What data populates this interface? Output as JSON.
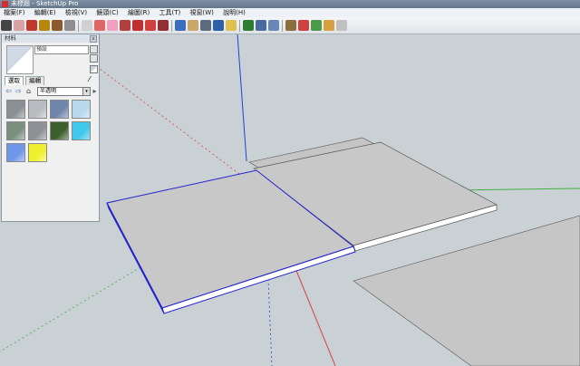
{
  "window": {
    "title": "未標題 - SketchUp Pro"
  },
  "menu": {
    "items": [
      "檔案(F)",
      "編輯(E)",
      "檢視(V)",
      "鏡頭(C)",
      "繪圖(R)",
      "工具(T)",
      "視窗(W)",
      "說明(H)"
    ]
  },
  "toolbar": {
    "buttons": [
      {
        "icon": "select-icon",
        "color": "#444444"
      },
      {
        "icon": "eraser-icon",
        "color": "#d9a3a3"
      },
      {
        "icon": "line-icon",
        "color": "#c0392b"
      },
      {
        "icon": "rectangle-icon",
        "color": "#b8860b"
      },
      {
        "icon": "circle-icon",
        "color": "#8b5a2b"
      },
      {
        "icon": "arc-icon",
        "color": "#8e8e8e"
      },
      {
        "icon": "make-component-icon",
        "color": "#d0d0d0"
      },
      {
        "icon": "paint-bucket-icon",
        "color": "#e06666"
      },
      {
        "icon": "eraser-icon",
        "color": "#f2a0c0"
      },
      {
        "icon": "push-pull-icon",
        "color": "#b04040"
      },
      {
        "icon": "move-icon",
        "color": "#c03030"
      },
      {
        "icon": "rotate-icon",
        "color": "#d04040"
      },
      {
        "icon": "offset-icon",
        "color": "#903030"
      },
      {
        "icon": "orbit-icon",
        "color": "#3a6fbf"
      },
      {
        "icon": "pan-icon",
        "color": "#c9a86a"
      },
      {
        "icon": "zoom-icon",
        "color": "#5a6c7d"
      },
      {
        "icon": "zoom-extents-icon",
        "color": "#2e5fa7"
      },
      {
        "icon": "previous-view-icon",
        "color": "#e0c050"
      },
      {
        "icon": "get-models-icon",
        "color": "#2e7d32"
      },
      {
        "icon": "share-model-icon",
        "color": "#4a6aa0"
      },
      {
        "icon": "share-component-icon",
        "color": "#6a88b5"
      },
      {
        "icon": "extension-warehouse-icon",
        "color": "#8a6f3d"
      },
      {
        "icon": "add-location-icon",
        "color": "#d04040"
      },
      {
        "icon": "toggle-terrain-icon",
        "color": "#4a9a4a"
      },
      {
        "icon": "photo-texture-icon",
        "color": "#d4a040"
      },
      {
        "icon": "geo-icon",
        "color": "#c0c0c0"
      }
    ]
  },
  "materials_panel": {
    "title": "材料",
    "name_field": "預設",
    "tabs": [
      "選取",
      "編輯"
    ],
    "library": "半透明",
    "library_arrow": "▾",
    "nav": [
      "⇦",
      "⇨",
      "⌂"
    ],
    "swatches": [
      {
        "name": "glass-block",
        "color": "#8a8f94"
      },
      {
        "name": "frosted-glass",
        "color": "#b8bcc0"
      },
      {
        "name": "blue-sky-glass",
        "color": "#6f86ad"
      },
      {
        "name": "light-blue-glass",
        "color": "#b8d8ee"
      },
      {
        "name": "green-striped-glass",
        "color": "#7a8f80"
      },
      {
        "name": "gray-tint",
        "color": "#8e9296"
      },
      {
        "name": "dark-green-tint",
        "color": "#3d5f2e"
      },
      {
        "name": "cyan-tint",
        "color": "#3fc8ea"
      },
      {
        "name": "blue-tint",
        "color": "#6f96e8"
      },
      {
        "name": "yellow-tint",
        "color": "#f0f030"
      }
    ]
  },
  "axes": {
    "x_color": "#d84040",
    "y_color": "#40b040",
    "z_color": "#2040d8"
  }
}
